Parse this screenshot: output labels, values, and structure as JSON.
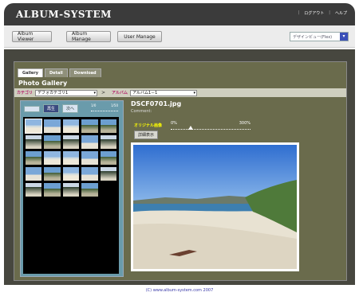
{
  "app": {
    "title": "ALBUM-SYSTEM"
  },
  "topnav": {
    "logout": "ログアウト",
    "help": "ヘルプ"
  },
  "nav": {
    "buttons": [
      "Album Viewer",
      "Album Manage",
      "User Manage"
    ],
    "view_select": "デザインビュー(Flex)"
  },
  "tabs": [
    "Gallery",
    "Detail",
    "Download"
  ],
  "section_title": "Photo Gallery",
  "filter": {
    "category_label": "カテゴリ",
    "category_value": "デフォカテゴリ1",
    "arrow": ">",
    "album_label": "アルバム",
    "album_value": "アルバム1－1"
  },
  "controls": {
    "btn1": "",
    "play": "再生",
    "next": "次へ",
    "slider_lo": "1/0",
    "slider_hi": "1/50"
  },
  "photo": {
    "filename": "DSCF0701.jpg",
    "comment_label": "Comment:",
    "original_label": "オリジナル画像",
    "zoom_lo": "0%",
    "zoom_hi": "300%",
    "zoom_level": 0.25,
    "detail_button": "詳細表示"
  },
  "footer": "(C) www.album-system.com 2007"
}
